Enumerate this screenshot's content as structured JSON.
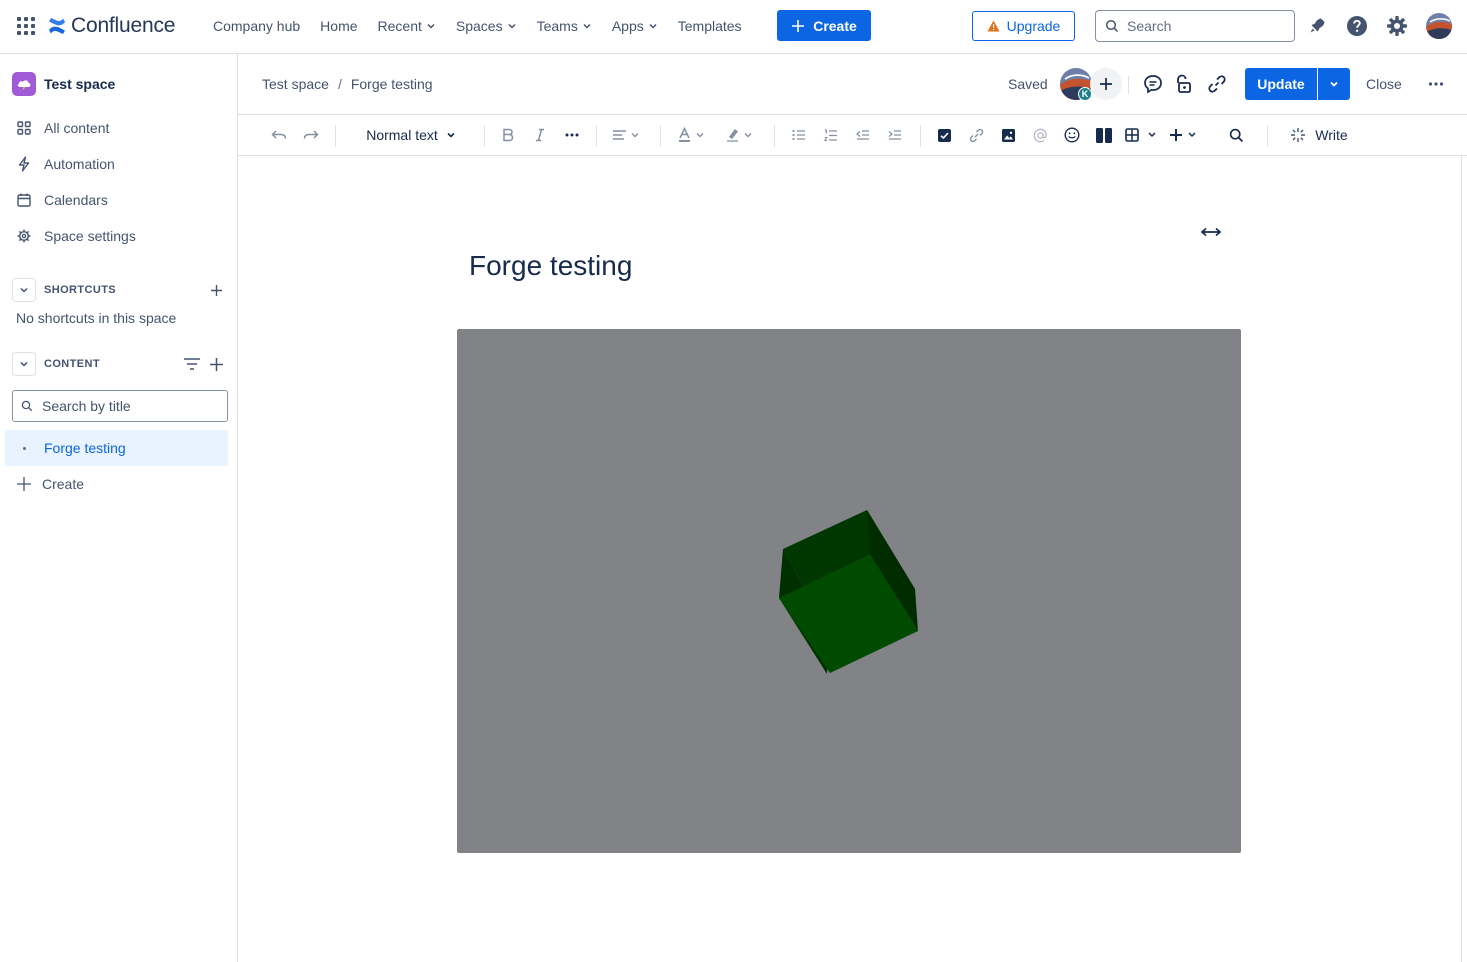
{
  "app": {
    "name": "Confluence"
  },
  "topnav": {
    "links": [
      {
        "label": "Company hub",
        "dropdown": false
      },
      {
        "label": "Home",
        "dropdown": false
      },
      {
        "label": "Recent",
        "dropdown": true
      },
      {
        "label": "Spaces",
        "dropdown": true
      },
      {
        "label": "Teams",
        "dropdown": true
      },
      {
        "label": "Apps",
        "dropdown": true
      },
      {
        "label": "Templates",
        "dropdown": false
      }
    ],
    "create_label": "Create",
    "upgrade_label": "Upgrade",
    "search_placeholder": "Search",
    "icons": [
      "app-switcher-icon",
      "notifications-icon",
      "help-icon",
      "settings-icon",
      "profile-avatar"
    ]
  },
  "sidebar": {
    "space_name": "Test space",
    "items": [
      {
        "label": "All content",
        "icon": "grid-icon"
      },
      {
        "label": "Automation",
        "icon": "lightning-icon"
      },
      {
        "label": "Calendars",
        "icon": "calendar-icon"
      },
      {
        "label": "Space settings",
        "icon": "gear-icon"
      }
    ],
    "shortcuts": {
      "label": "SHORTCUTS",
      "empty_text": "No shortcuts in this space"
    },
    "content": {
      "label": "CONTENT",
      "search_placeholder": "Search by title",
      "pages": [
        {
          "label": "Forge testing",
          "selected": true
        }
      ],
      "create_label": "Create"
    }
  },
  "editor": {
    "breadcrumb": [
      "Test space",
      "Forge testing"
    ],
    "status": "Saved",
    "collaborator_initial": "K",
    "update_label": "Update",
    "close_label": "Close",
    "toolbar": {
      "text_style": "Normal text",
      "write_label": "Write"
    }
  },
  "page": {
    "title": "Forge testing",
    "embed": {
      "background": "#818387",
      "object": "green-cube"
    }
  },
  "colors": {
    "accent": "#0c66e4",
    "selected_bg": "#e9f2ff",
    "text": "#172b4d",
    "subtle_text": "#44546f",
    "space_icon": "#a05bd6",
    "cube_front": "#004b00",
    "cube_top": "#003700",
    "cube_side": "#002c00"
  }
}
